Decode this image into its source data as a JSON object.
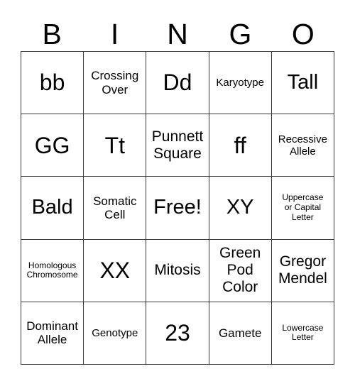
{
  "card": {
    "header_letters": [
      "B",
      "I",
      "N",
      "G",
      "O"
    ],
    "columns": 5,
    "rows": 5,
    "free_space_label": "Free!",
    "colors": {
      "background": "#ffffff",
      "text": "#000000",
      "grid_line": "#3a3a3a"
    },
    "cells": [
      {
        "text": "bb",
        "size": "xxl"
      },
      {
        "text": "Crossing\nOver",
        "size": "sm"
      },
      {
        "text": "Dd",
        "size": "xxl"
      },
      {
        "text": "Karyotype",
        "size": "xs"
      },
      {
        "text": "Tall",
        "size": "xl"
      },
      {
        "text": "GG",
        "size": "xxl"
      },
      {
        "text": "Tt",
        "size": "xxl"
      },
      {
        "text": "Punnett\nSquare",
        "size": "md"
      },
      {
        "text": "ff",
        "size": "xxl"
      },
      {
        "text": "Recessive\nAllele",
        "size": "xs"
      },
      {
        "text": "Bald",
        "size": "xl"
      },
      {
        "text": "Somatic\nCell",
        "size": "sm"
      },
      {
        "text": "Free!",
        "size": "xl"
      },
      {
        "text": "XY",
        "size": "xl"
      },
      {
        "text": "Uppercase\nor Capital\nLetter",
        "size": "xxs"
      },
      {
        "text": "Homologous\nChromosome",
        "size": "xxs"
      },
      {
        "text": "XX",
        "size": "xxl"
      },
      {
        "text": "Mitosis",
        "size": "md"
      },
      {
        "text": "Green\nPod\nColor",
        "size": "md"
      },
      {
        "text": "Gregor\nMendel",
        "size": "md"
      },
      {
        "text": "Dominant\nAllele",
        "size": "sm"
      },
      {
        "text": "Genotype",
        "size": "xs"
      },
      {
        "text": "23",
        "size": "xxl"
      },
      {
        "text": "Gamete",
        "size": "sm"
      },
      {
        "text": "Lowercase\nLetter",
        "size": "xxs"
      }
    ]
  }
}
